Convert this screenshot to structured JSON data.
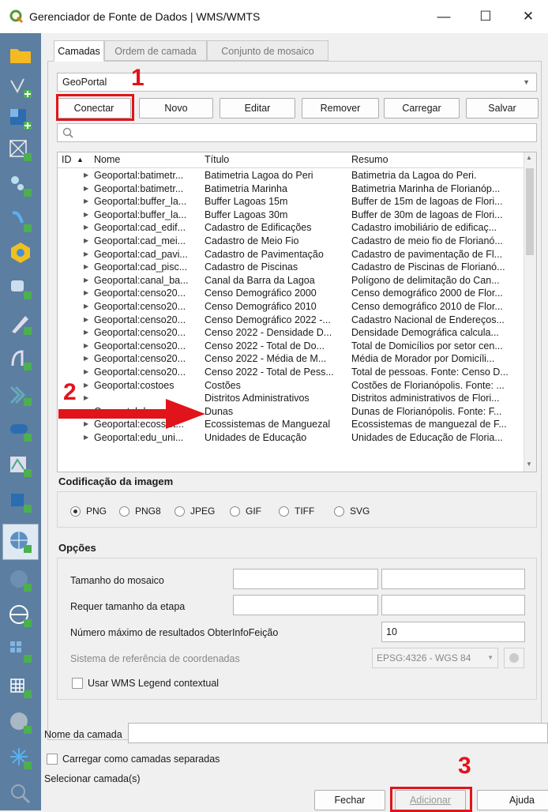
{
  "window": {
    "title": "Gerenciador de Fonte de Dados | WMS/WMTS",
    "minimize": "—",
    "maximize": "☐",
    "close": "✕"
  },
  "tabs": [
    {
      "label": "Camadas"
    },
    {
      "label": "Ordem de camada"
    },
    {
      "label": "Conjunto de mosaico"
    }
  ],
  "connection": {
    "selected": "GeoPortal"
  },
  "buttons": {
    "connect": "Conectar",
    "new": "Novo",
    "edit": "Editar",
    "remove": "Remover",
    "load": "Carregar",
    "save": "Salvar"
  },
  "search": {
    "placeholder": ""
  },
  "table": {
    "headers": {
      "id": "ID",
      "name": "Nome",
      "title": "Título",
      "summary": "Resumo"
    },
    "rows": [
      {
        "name": "Geoportal:batimetr...",
        "title": "Batimetria Lagoa do Peri",
        "summary": "Batimetria da Lagoa do Peri."
      },
      {
        "name": "Geoportal:batimetr...",
        "title": "Batimetria Marinha",
        "summary": "Batimetria Marinha de Florianóp..."
      },
      {
        "name": "Geoportal:buffer_la...",
        "title": "Buffer Lagoas 15m",
        "summary": "Buffer de 15m de lagoas de Flori..."
      },
      {
        "name": "Geoportal:buffer_la...",
        "title": "Buffer Lagoas 30m",
        "summary": "Buffer de 30m de lagoas de Flori..."
      },
      {
        "name": "Geoportal:cad_edif...",
        "title": "Cadastro de Edificações",
        "summary": "Cadastro imobiliário de edificaç..."
      },
      {
        "name": "Geoportal:cad_mei...",
        "title": "Cadastro de Meio Fio",
        "summary": "Cadastro de meio fio de Florianó..."
      },
      {
        "name": "Geoportal:cad_pavi...",
        "title": "Cadastro de Pavimentação",
        "summary": "Cadastro de pavimentação de Fl..."
      },
      {
        "name": "Geoportal:cad_pisc...",
        "title": "Cadastro de Piscinas",
        "summary": "Cadastro de Piscinas de Florianó..."
      },
      {
        "name": "Geoportal:canal_ba...",
        "title": "Canal da Barra da Lagoa",
        "summary": "Polígono de delimitação do Can..."
      },
      {
        "name": "Geoportal:censo20...",
        "title": "Censo Demográfico 2000",
        "summary": "Censo demográfico 2000 de Flor..."
      },
      {
        "name": "Geoportal:censo20...",
        "title": "Censo Demográfico 2010",
        "summary": "Censo demográfico 2010 de Flor..."
      },
      {
        "name": "Geoportal:censo20...",
        "title": "Censo Demográfico 2022 -...",
        "summary": "Cadastro Nacional de Endereços..."
      },
      {
        "name": "Geoportal:censo20...",
        "title": "Censo 2022 - Densidade D...",
        "summary": "Densidade Demográfica calcula..."
      },
      {
        "name": "Geoportal:censo20...",
        "title": "Censo 2022 - Total de Do...",
        "summary": "Total de Domicílios por setor cen..."
      },
      {
        "name": "Geoportal:censo20...",
        "title": "Censo 2022 - Média de M...",
        "summary": "Média de Morador por Domicíli..."
      },
      {
        "name": "Geoportal:censo20...",
        "title": "Censo 2022 - Total de Pess...",
        "summary": "Total de pessoas. Fonte: Censo D..."
      },
      {
        "name": "Geoportal:costoes",
        "title": "Costões",
        "summary": "Costões de Florianópolis. Fonte: ..."
      },
      {
        "name": "",
        "title": "Distritos Administrativos",
        "summary": "Distritos administrativos de Flori..."
      },
      {
        "name": "Geoportal:dunas",
        "title": "Dunas",
        "summary": "Dunas de Florianópolis. Fonte: F..."
      },
      {
        "name": "Geoportal:ecossist...",
        "title": "Ecossistemas de Manguezal",
        "summary": "Ecossistemas de manguezal de F..."
      },
      {
        "name": "Geoportal:edu_uni...",
        "title": "Unidades de Educação",
        "summary": "Unidades de Educação de Floria..."
      }
    ]
  },
  "encoding": {
    "title": "Codificação da imagem",
    "options": [
      {
        "label": "PNG",
        "selected": true
      },
      {
        "label": "PNG8",
        "selected": false
      },
      {
        "label": "JPEG",
        "selected": false
      },
      {
        "label": "GIF",
        "selected": false
      },
      {
        "label": "TIFF",
        "selected": false
      },
      {
        "label": "SVG",
        "selected": false
      }
    ]
  },
  "options": {
    "title": "Opções",
    "tile_size": "Tamanho do mosaico",
    "step_size": "Requer tamanho da etapa",
    "max_results": "Número máximo de resultados ObterInfoFeição",
    "max_results_value": "10",
    "crs_label": "Sistema de referência de coordenadas",
    "crs_value": "EPSG:4326 - WGS 84",
    "contextual_legend": "Usar WMS Legend contextual"
  },
  "layer_name_label": "Nome da camada",
  "load_separate": "Carregar como camadas separadas",
  "select_layers": "Selecionar camada(s)",
  "footer": {
    "close": "Fechar",
    "add": "Adicionar",
    "help": "Ajuda"
  },
  "annotations": {
    "step1": "1",
    "step2": "2",
    "step3": "3"
  },
  "colors": {
    "highlight_red": "#e0141a",
    "sidebar": "#5c7ea0"
  }
}
